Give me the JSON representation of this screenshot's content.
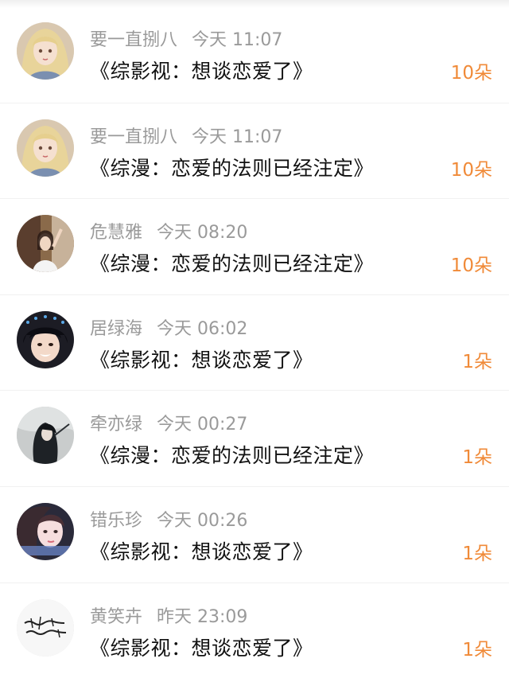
{
  "items": [
    {
      "name": "要一直捌八",
      "time": "今天 11:07",
      "title": "《综影视：想谈恋爱了》",
      "count": "10朵",
      "avatar": "avatar-blonde-girl"
    },
    {
      "name": "要一直捌八",
      "time": "今天 11:07",
      "title": "《综漫：恋爱的法则已经注定》",
      "count": "10朵",
      "avatar": "avatar-blonde-girl"
    },
    {
      "name": "危慧雅",
      "time": "今天 08:20",
      "title": "《综漫：恋爱的法则已经注定》",
      "count": "10朵",
      "avatar": "avatar-photo-girl"
    },
    {
      "name": "居绿海",
      "time": "今天 06:02",
      "title": "《综影视：想谈恋爱了》",
      "count": "1朵",
      "avatar": "avatar-boy-face"
    },
    {
      "name": "牵亦绿",
      "time": "今天 00:27",
      "title": "《综漫：恋爱的法则已经注定》",
      "count": "1朵",
      "avatar": "avatar-dark-anime"
    },
    {
      "name": "错乐珍",
      "time": "今天 00:26",
      "title": "《综影视：想谈恋爱了》",
      "count": "1朵",
      "avatar": "avatar-girl-pink"
    },
    {
      "name": "黄笑卉",
      "time": "昨天 23:09",
      "title": "《综影视：想谈恋爱了》",
      "count": "1朵",
      "avatar": "avatar-calligraphy"
    }
  ],
  "colors": {
    "count": "#f08a38",
    "meta": "#9a9a9a",
    "title": "#111111"
  }
}
